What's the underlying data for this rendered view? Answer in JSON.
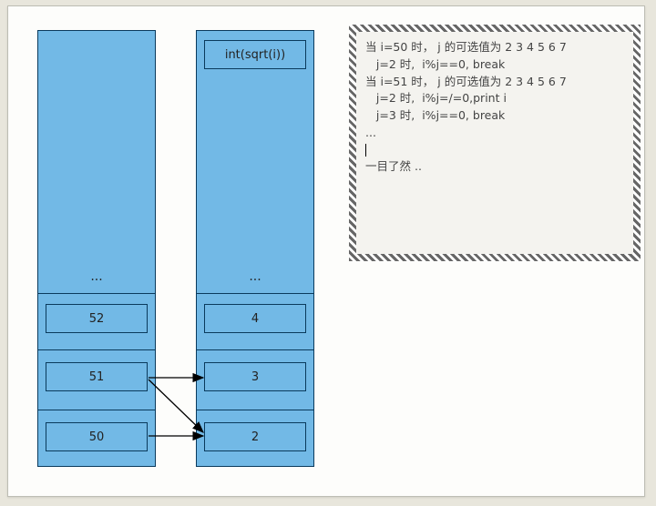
{
  "left_column": {
    "header": "",
    "ellipsis": "...",
    "cells": [
      "52",
      "51",
      "50"
    ]
  },
  "right_column": {
    "header": "int(sqrt(i))",
    "ellipsis": "...",
    "cells": [
      "4",
      "3",
      "2"
    ]
  },
  "trace": {
    "lines": [
      "当 i=50 时， j 的可选值为 2 3 4 5 6 7",
      "   j=2 时,  i%j==0, break",
      "当 i=51 时， j 的可选值为 2 3 4 5 6 7",
      "   j=2 时,  i%j=/=0,print i",
      "   j=3 时,  i%j==0, break",
      "",
      "...",
      "",
      "一目了然 .."
    ]
  }
}
